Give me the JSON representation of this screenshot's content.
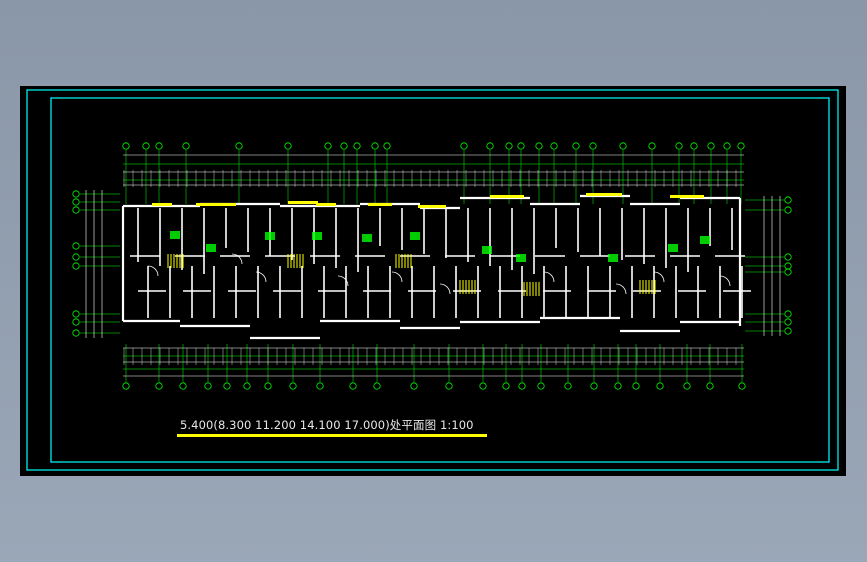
{
  "drawing": {
    "title": "5.400(8.300 11.200 14.100 17.000)处平面图 1:100",
    "background_color": "#000000",
    "frame_color": "#00ffff",
    "wall_color": "#ffffff",
    "axis_color": "#00ff00",
    "highlight_color": "#ffff00",
    "dim_color": "#ffffff"
  }
}
